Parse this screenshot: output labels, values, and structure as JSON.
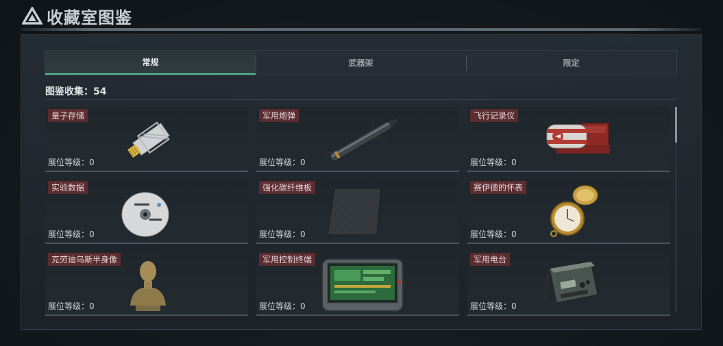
{
  "header": {
    "title": "收藏室图鉴",
    "logo_icon": "triangle-logo-icon"
  },
  "tabs": [
    {
      "label": "常规",
      "active": true
    },
    {
      "label": "武器架",
      "active": false
    },
    {
      "label": "限定",
      "active": false
    }
  ],
  "collection": {
    "count_text": "图鉴收集：54"
  },
  "items": [
    {
      "name": "量子存储",
      "level": "展位等级：0",
      "icon": "usb-drive-icon"
    },
    {
      "name": "军用炮弹",
      "level": "展位等级：0",
      "icon": "missile-icon"
    },
    {
      "name": "飞行记录仪",
      "level": "展位等级：0",
      "icon": "flight-recorder-icon"
    },
    {
      "name": "实验数据",
      "level": "展位等级：0",
      "icon": "disc-icon"
    },
    {
      "name": "强化碳纤维板",
      "level": "展位等级：0",
      "icon": "carbon-plate-icon"
    },
    {
      "name": "赛伊德的怀表",
      "level": "展位等级：0",
      "icon": "pocket-watch-icon"
    },
    {
      "name": "克劳迪乌斯半身像",
      "level": "展位等级：0",
      "icon": "bust-icon"
    },
    {
      "name": "军用控制终端",
      "level": "展位等级：0",
      "icon": "control-terminal-icon"
    },
    {
      "name": "军用电台",
      "level": "展位等级：0",
      "icon": "radio-icon"
    }
  ],
  "colors": {
    "accent": "#4fc0a0",
    "name_badge": "#5b2c30",
    "background": "#14191e"
  }
}
